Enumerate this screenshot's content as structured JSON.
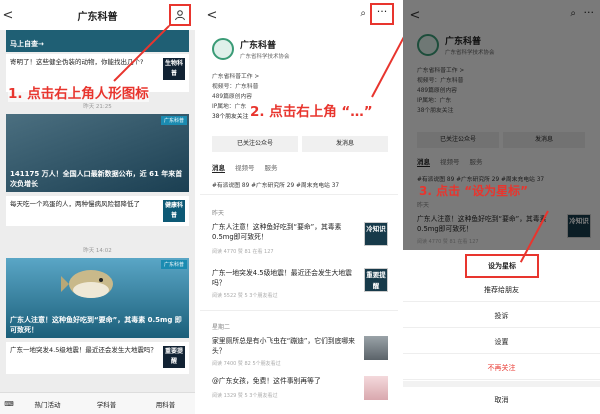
{
  "panel1": {
    "back": "<",
    "title": "广东科普",
    "card_top": "考……2019……\n马上自查→",
    "card_top_line": "马上自查→",
    "item1": "寄明了！这些健全伪装的动物，你能找出几个?",
    "item1_tag": "生物科普",
    "time1": "昨天 21:25",
    "card2_badge": "广东科普",
    "card2_text": "141175 万人！全国人口最新数据公布，近 61 年来首次负增长",
    "item2": "每天吃一个鸡蛋的人，两种慢病风险都降低了",
    "item2_tag": "健康科普",
    "time2": "昨天 14:02",
    "card3_badge": "广东科普",
    "card3_text": "广东人注意！这种鱼好吃到“要命”，其毒素 0.5mg 即可致死！",
    "item3": "广东一地突发4.5级地震！最近还会发生大地震吗？",
    "item3_tag": "重要提醒",
    "bottom": [
      "热门活动",
      "学科普",
      "用科普"
    ],
    "annotation": "1. 点击右上角人形图标"
  },
  "panel2": {
    "back": "<",
    "name": "广东科普",
    "sub": "广东省科学技术协会",
    "info": [
      "广东省科普工作 >",
      "视频号：广东科普",
      "489篇原创内容",
      "IP属地：广东",
      "38个朋友关注"
    ],
    "follow_btn": "已关注公众号",
    "msg_btn": "发消息",
    "tabs": [
      "消息",
      "视频号",
      "服务"
    ],
    "hashtags": "#有派说图 89  #广东研究所 29  #周末充电站 37",
    "section1": "昨天",
    "a1": "广东人注意！这种鱼好吃到“要命”，其毒素0.5mg即可致死！",
    "a1_meta": "阅读 4770  赞 81  在看 127",
    "a1_tag": "冷知识",
    "a2": "广东一地突发4.5级地震！最近还会发生大地震吗？",
    "a2_meta": "阅读 5522  赞 5  3个朋友看过",
    "a2_tag": "重要提醒",
    "section2": "星期二",
    "a3": "家里厕所总是有小飞虫在“蹦迪”，它们到底哪来头？",
    "a3_meta": "阅读 7400  赞 82  5个朋友看过",
    "a4": "@广东女孩，免费！这件事别再等了",
    "a4_meta": "阅读 1329  赞 5  3个朋友看过",
    "annotation": "2. 点击右上角 “…”"
  },
  "panel3": {
    "back": "<",
    "name": "广东科普",
    "sub": "广东省科学技术协会",
    "info": [
      "广东省科普工作 >",
      "视频号：广东科普",
      "489篇原创内容",
      "IP属地：广东",
      "38个朋友关注"
    ],
    "follow_btn": "已关注公众号",
    "msg_btn": "发消息",
    "tabs": [
      "消息",
      "视频号",
      "服务"
    ],
    "hashtags": "#有派说图 89  #广东研究所 29  #周末充电站 37",
    "section1": "昨天",
    "a1": "广东人注意！这种鱼好吃到“要命”，其毒素0.5mg即可致死！",
    "a1_meta": "阅读 4770  赞 81  在看 127",
    "a1_tag": "冷知识",
    "sheet": [
      "设为星标",
      "推荐给朋友",
      "投诉",
      "设置",
      "不再关注",
      "取消"
    ],
    "annotation": "3. 点击 “设为星标”"
  },
  "colors": {
    "annotation": "#e8352e",
    "dark_card": "#1f5f74",
    "unfollow": "#e8352e"
  }
}
